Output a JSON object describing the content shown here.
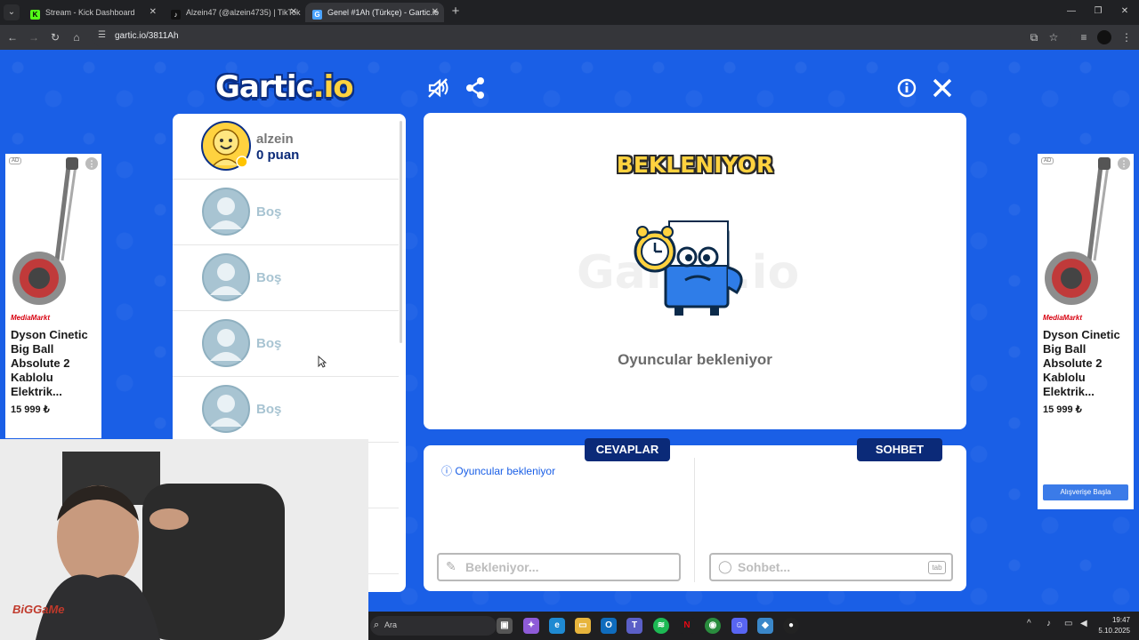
{
  "browser": {
    "tabs": [
      {
        "title": "Stream - Kick Dashboard",
        "favicon": "K",
        "color": "#53fc18",
        "active": false
      },
      {
        "title": "Alzein47 (@alzein4735) | TikTok",
        "favicon": "♪",
        "color": "#ffffff",
        "active": false
      },
      {
        "title": "Genel #1Ah (Türkçe) - Gartic.io",
        "favicon": "G",
        "color": "#4aa3ff",
        "active": true
      }
    ],
    "url": "gartic.io/3811Ah"
  },
  "game": {
    "logo_main": "Gartic",
    "logo_suffix": ".io",
    "players": [
      {
        "name": "alzein",
        "score": "0 puan",
        "filled": true
      },
      {
        "name": "Boş",
        "filled": false
      },
      {
        "name": "Boş",
        "filled": false
      },
      {
        "name": "Boş",
        "filled": false
      },
      {
        "name": "Boş",
        "filled": false
      }
    ],
    "status_title": "BEKLENIYOR",
    "watermark": "Gartic.io",
    "waiting_text": "Oyuncular bekleniyor",
    "answers_tab": "CEVAPLAR",
    "chat_tab": "SOHBET",
    "answers_info": "Oyuncular bekleniyor",
    "answer_placeholder": "Bekleniyor...",
    "chat_placeholder": "Sohbet...",
    "tab_key": "tab"
  },
  "ads": {
    "badge": "AD",
    "brand": "MediaMarkt",
    "title": "Dyson Cinetic Big Ball Absolute 2 Kablolu Elektrik...",
    "price": "15 999 ₺",
    "cta": "Alışverişe Başla"
  },
  "webcam": {
    "label": "BiGGaMe"
  },
  "taskbar": {
    "search_placeholder": "Ara",
    "time": "19:47",
    "date": "5.10.2025"
  }
}
